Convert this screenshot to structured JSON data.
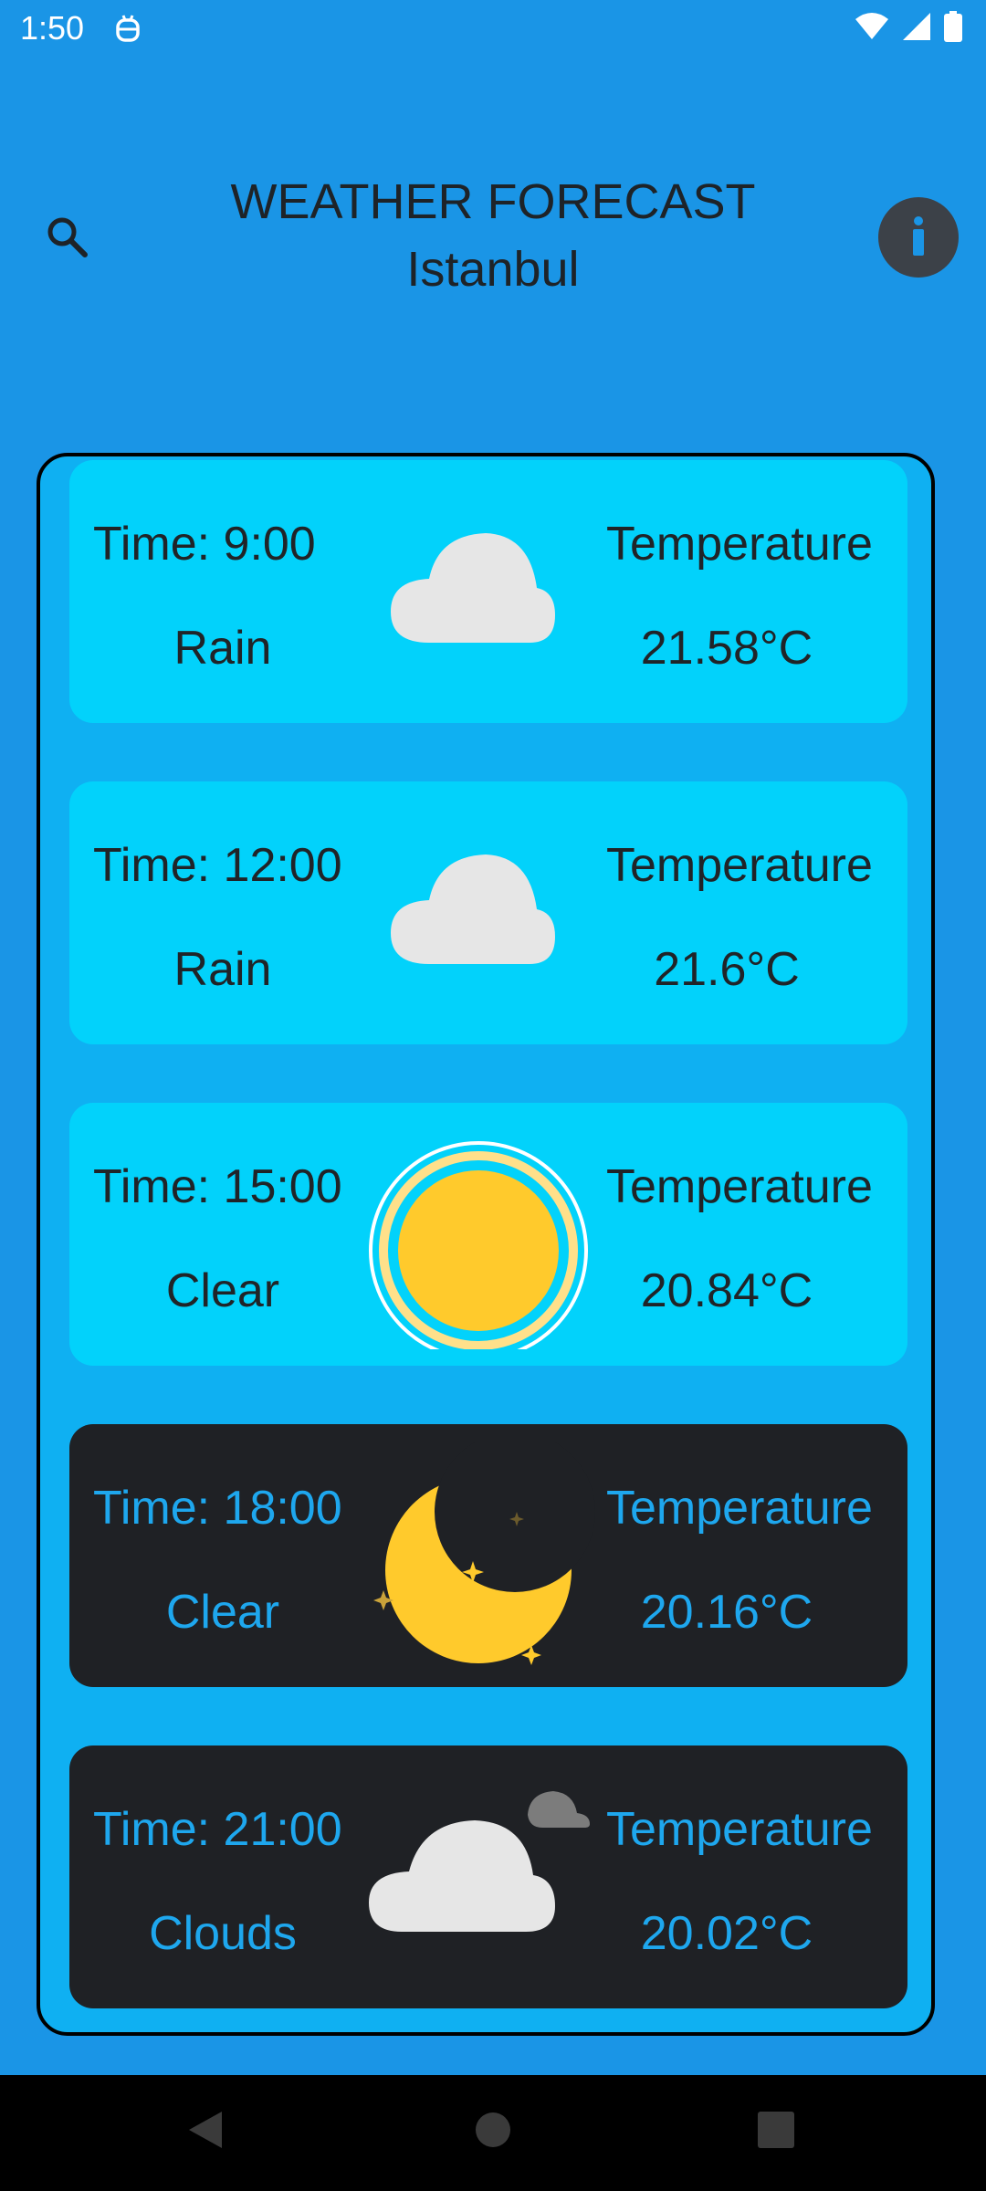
{
  "status_bar": {
    "time": "1:50",
    "icons": [
      "assistant-icon",
      "wifi-icon",
      "signal-icon",
      "battery-icon"
    ]
  },
  "header": {
    "title": "WEATHER FORECAST",
    "city": "Istanbul",
    "search_icon": "search-icon",
    "info_icon": "info-icon"
  },
  "forecasts": [
    {
      "time": "Time: 9:00",
      "condition": "Rain",
      "temp_label": "Temperature",
      "temp": "21.58°C",
      "icon": "rain-cloud-icon",
      "theme": "day"
    },
    {
      "time": "Time: 12:00",
      "condition": "Rain",
      "temp_label": "Temperature",
      "temp": "21.6°C",
      "icon": "rain-cloud-icon",
      "theme": "day"
    },
    {
      "time": "Time: 15:00",
      "condition": "Clear",
      "temp_label": "Temperature",
      "temp": "20.84°C",
      "icon": "sun-icon",
      "theme": "day"
    },
    {
      "time": "Time: 18:00",
      "condition": "Clear",
      "temp_label": "Temperature",
      "temp": "20.16°C",
      "icon": "moon-icon",
      "theme": "night"
    },
    {
      "time": "Time: 21:00",
      "condition": "Clouds",
      "temp_label": "Temperature",
      "temp": "20.02°C",
      "icon": "clouds-icon",
      "theme": "night"
    }
  ],
  "colors": {
    "background": "#1a95e6",
    "list_background": "#0fb0f2",
    "day_card": "#02d2fb",
    "night_card": "#1f2125",
    "night_text": "#1ea7ee",
    "sun": "#ffca2c",
    "cloud": "#e6e6e6"
  },
  "nav_bar": {
    "icons": [
      "back-icon",
      "home-icon",
      "recents-icon"
    ]
  }
}
